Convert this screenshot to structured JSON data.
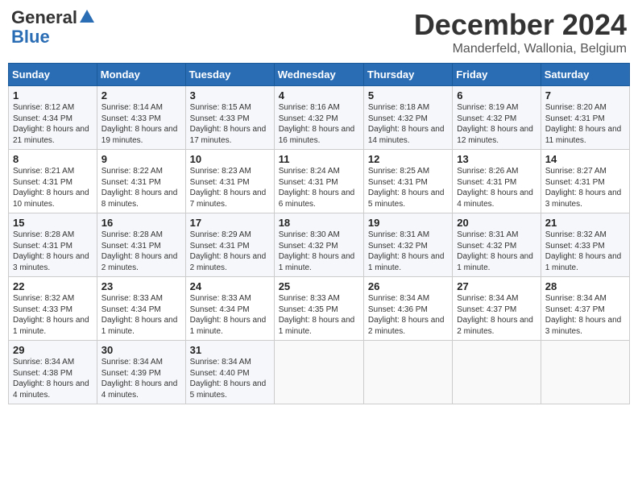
{
  "header": {
    "logo_general": "General",
    "logo_blue": "Blue",
    "month_title": "December 2024",
    "subtitle": "Manderfeld, Wallonia, Belgium"
  },
  "days_of_week": [
    "Sunday",
    "Monday",
    "Tuesday",
    "Wednesday",
    "Thursday",
    "Friday",
    "Saturday"
  ],
  "weeks": [
    [
      {
        "day": "1",
        "sunrise": "Sunrise: 8:12 AM",
        "sunset": "Sunset: 4:34 PM",
        "daylight": "Daylight: 8 hours and 21 minutes."
      },
      {
        "day": "2",
        "sunrise": "Sunrise: 8:14 AM",
        "sunset": "Sunset: 4:33 PM",
        "daylight": "Daylight: 8 hours and 19 minutes."
      },
      {
        "day": "3",
        "sunrise": "Sunrise: 8:15 AM",
        "sunset": "Sunset: 4:33 PM",
        "daylight": "Daylight: 8 hours and 17 minutes."
      },
      {
        "day": "4",
        "sunrise": "Sunrise: 8:16 AM",
        "sunset": "Sunset: 4:32 PM",
        "daylight": "Daylight: 8 hours and 16 minutes."
      },
      {
        "day": "5",
        "sunrise": "Sunrise: 8:18 AM",
        "sunset": "Sunset: 4:32 PM",
        "daylight": "Daylight: 8 hours and 14 minutes."
      },
      {
        "day": "6",
        "sunrise": "Sunrise: 8:19 AM",
        "sunset": "Sunset: 4:32 PM",
        "daylight": "Daylight: 8 hours and 12 minutes."
      },
      {
        "day": "7",
        "sunrise": "Sunrise: 8:20 AM",
        "sunset": "Sunset: 4:31 PM",
        "daylight": "Daylight: 8 hours and 11 minutes."
      }
    ],
    [
      {
        "day": "8",
        "sunrise": "Sunrise: 8:21 AM",
        "sunset": "Sunset: 4:31 PM",
        "daylight": "Daylight: 8 hours and 10 minutes."
      },
      {
        "day": "9",
        "sunrise": "Sunrise: 8:22 AM",
        "sunset": "Sunset: 4:31 PM",
        "daylight": "Daylight: 8 hours and 8 minutes."
      },
      {
        "day": "10",
        "sunrise": "Sunrise: 8:23 AM",
        "sunset": "Sunset: 4:31 PM",
        "daylight": "Daylight: 8 hours and 7 minutes."
      },
      {
        "day": "11",
        "sunrise": "Sunrise: 8:24 AM",
        "sunset": "Sunset: 4:31 PM",
        "daylight": "Daylight: 8 hours and 6 minutes."
      },
      {
        "day": "12",
        "sunrise": "Sunrise: 8:25 AM",
        "sunset": "Sunset: 4:31 PM",
        "daylight": "Daylight: 8 hours and 5 minutes."
      },
      {
        "day": "13",
        "sunrise": "Sunrise: 8:26 AM",
        "sunset": "Sunset: 4:31 PM",
        "daylight": "Daylight: 8 hours and 4 minutes."
      },
      {
        "day": "14",
        "sunrise": "Sunrise: 8:27 AM",
        "sunset": "Sunset: 4:31 PM",
        "daylight": "Daylight: 8 hours and 3 minutes."
      }
    ],
    [
      {
        "day": "15",
        "sunrise": "Sunrise: 8:28 AM",
        "sunset": "Sunset: 4:31 PM",
        "daylight": "Daylight: 8 hours and 3 minutes."
      },
      {
        "day": "16",
        "sunrise": "Sunrise: 8:28 AM",
        "sunset": "Sunset: 4:31 PM",
        "daylight": "Daylight: 8 hours and 2 minutes."
      },
      {
        "day": "17",
        "sunrise": "Sunrise: 8:29 AM",
        "sunset": "Sunset: 4:31 PM",
        "daylight": "Daylight: 8 hours and 2 minutes."
      },
      {
        "day": "18",
        "sunrise": "Sunrise: 8:30 AM",
        "sunset": "Sunset: 4:32 PM",
        "daylight": "Daylight: 8 hours and 1 minute."
      },
      {
        "day": "19",
        "sunrise": "Sunrise: 8:31 AM",
        "sunset": "Sunset: 4:32 PM",
        "daylight": "Daylight: 8 hours and 1 minute."
      },
      {
        "day": "20",
        "sunrise": "Sunrise: 8:31 AM",
        "sunset": "Sunset: 4:32 PM",
        "daylight": "Daylight: 8 hours and 1 minute."
      },
      {
        "day": "21",
        "sunrise": "Sunrise: 8:32 AM",
        "sunset": "Sunset: 4:33 PM",
        "daylight": "Daylight: 8 hours and 1 minute."
      }
    ],
    [
      {
        "day": "22",
        "sunrise": "Sunrise: 8:32 AM",
        "sunset": "Sunset: 4:33 PM",
        "daylight": "Daylight: 8 hours and 1 minute."
      },
      {
        "day": "23",
        "sunrise": "Sunrise: 8:33 AM",
        "sunset": "Sunset: 4:34 PM",
        "daylight": "Daylight: 8 hours and 1 minute."
      },
      {
        "day": "24",
        "sunrise": "Sunrise: 8:33 AM",
        "sunset": "Sunset: 4:34 PM",
        "daylight": "Daylight: 8 hours and 1 minute."
      },
      {
        "day": "25",
        "sunrise": "Sunrise: 8:33 AM",
        "sunset": "Sunset: 4:35 PM",
        "daylight": "Daylight: 8 hours and 1 minute."
      },
      {
        "day": "26",
        "sunrise": "Sunrise: 8:34 AM",
        "sunset": "Sunset: 4:36 PM",
        "daylight": "Daylight: 8 hours and 2 minutes."
      },
      {
        "day": "27",
        "sunrise": "Sunrise: 8:34 AM",
        "sunset": "Sunset: 4:37 PM",
        "daylight": "Daylight: 8 hours and 2 minutes."
      },
      {
        "day": "28",
        "sunrise": "Sunrise: 8:34 AM",
        "sunset": "Sunset: 4:37 PM",
        "daylight": "Daylight: 8 hours and 3 minutes."
      }
    ],
    [
      {
        "day": "29",
        "sunrise": "Sunrise: 8:34 AM",
        "sunset": "Sunset: 4:38 PM",
        "daylight": "Daylight: 8 hours and 4 minutes."
      },
      {
        "day": "30",
        "sunrise": "Sunrise: 8:34 AM",
        "sunset": "Sunset: 4:39 PM",
        "daylight": "Daylight: 8 hours and 4 minutes."
      },
      {
        "day": "31",
        "sunrise": "Sunrise: 8:34 AM",
        "sunset": "Sunset: 4:40 PM",
        "daylight": "Daylight: 8 hours and 5 minutes."
      },
      null,
      null,
      null,
      null
    ]
  ]
}
